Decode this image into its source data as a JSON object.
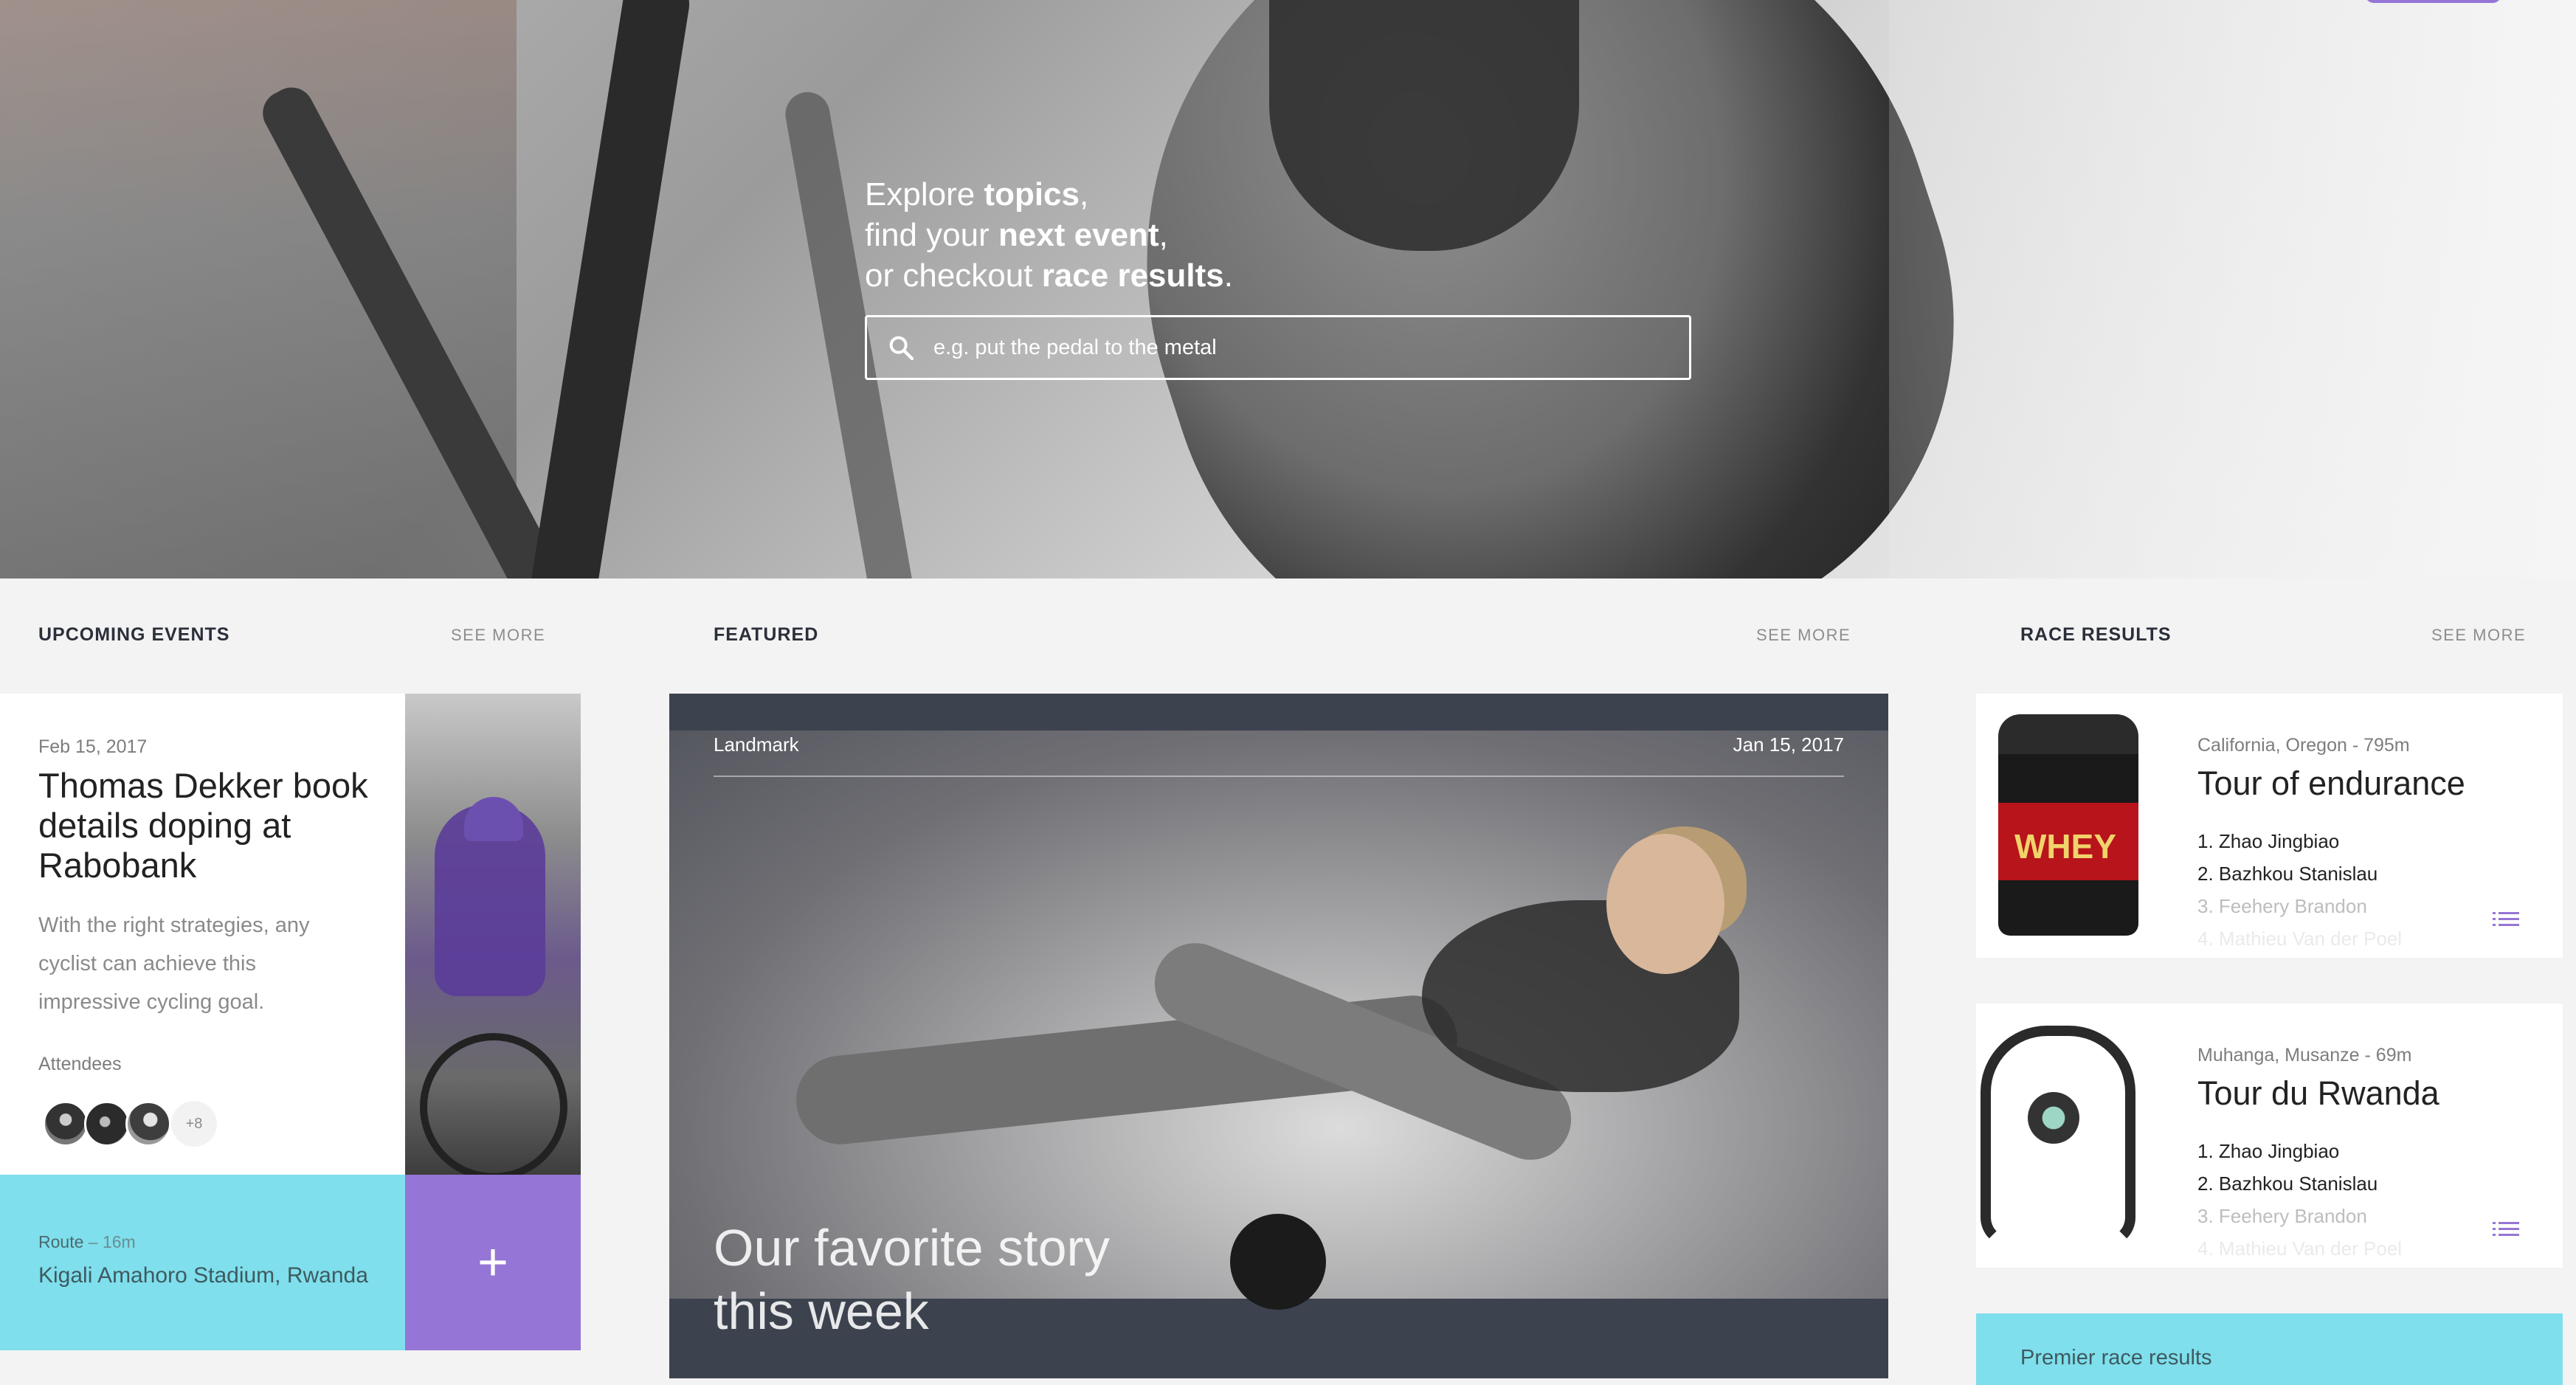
{
  "hero": {
    "line1_a": "Explore ",
    "line1_b": "topics",
    "line1_c": ",",
    "line2_a": "find your ",
    "line2_b": "next event",
    "line2_c": ",",
    "line3_a": "or checkout ",
    "line3_b": "race results",
    "line3_c": ".",
    "search_placeholder": "e.g. put the pedal to the metal"
  },
  "sections": {
    "upcoming_title": "UPCOMING EVENTS",
    "upcoming_more": "SEE MORE",
    "featured_title": "FEATURED",
    "featured_more": "SEE MORE",
    "results_title": "RACE RESULTS",
    "results_more": "SEE MORE"
  },
  "event": {
    "date": "Feb 15, 2017",
    "title": "Thomas Dekker book details doping at Rabobank",
    "description": "With the right strategies, any cyclist can achieve this impressive cycling goal.",
    "attendees_label": "Attendees",
    "attendees_more": "+8",
    "route_label": "Route",
    "route_distance": "– 16m",
    "route_place": "Kigali Amahoro Stadium, Rwanda",
    "add_label": "+"
  },
  "featured": {
    "category": "Landmark",
    "date": "Jan 15, 2017",
    "headline": "Our favorite story this week"
  },
  "results": [
    {
      "location": "California, Oregon - 795m",
      "title": "Tour of endurance",
      "product_text": "WHEY",
      "ranking": [
        "1. Zhao Jingbiao",
        "2. Bazhkou Stanislau",
        "3. Feehery Brandon",
        "4. Mathieu Van der Poel"
      ]
    },
    {
      "location": "Muhanga, Musanze - 69m",
      "title": "Tour du Rwanda",
      "ranking": [
        "1. Zhao Jingbiao",
        "2. Bazhkou Stanislau",
        "3. Feehery Brandon",
        "4. Mathieu Van der Poel"
      ]
    }
  ],
  "premier": {
    "label": "Premier race results"
  },
  "colors": {
    "accent": "#9575d6",
    "cyan": "#7fdfec",
    "featured_bg": "#3d424f"
  }
}
